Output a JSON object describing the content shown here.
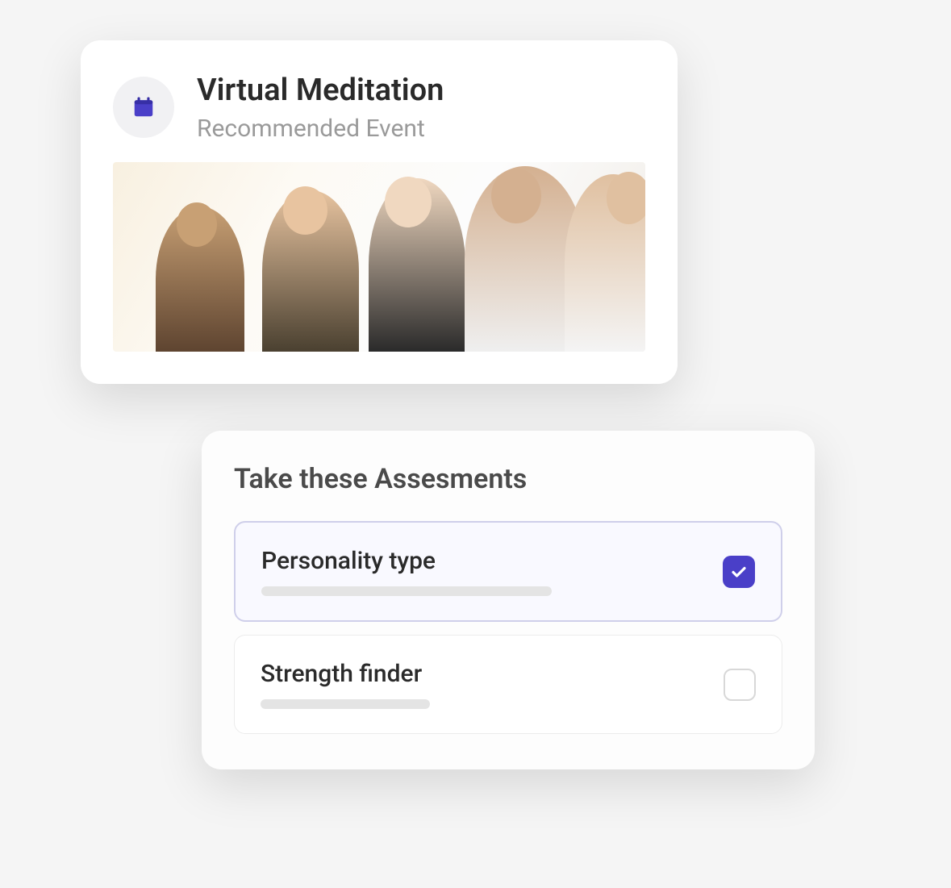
{
  "event": {
    "title": "Virtual Meditation",
    "subtitle": "Recommended Event",
    "icon": "calendar-icon"
  },
  "assessments": {
    "heading": "Take these Assesments",
    "items": [
      {
        "label": "Personality type",
        "checked": true
      },
      {
        "label": "Strength finder",
        "checked": false
      }
    ]
  },
  "colors": {
    "accent": "#4a3fc8",
    "selected_border": "#cfcfea",
    "selected_bg": "#f9f9ff"
  }
}
